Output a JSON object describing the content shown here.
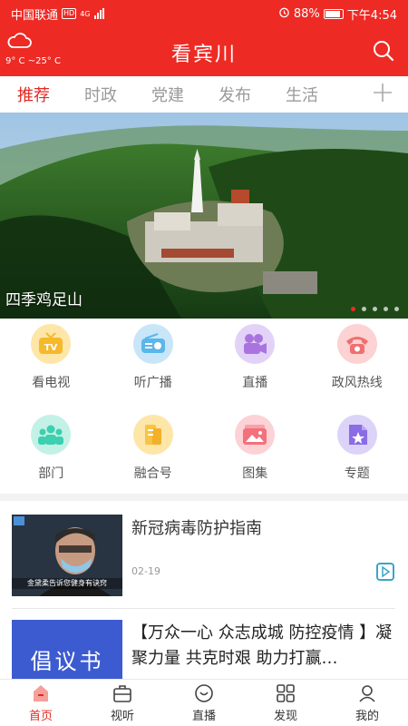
{
  "status": {
    "carrier": "中国联通",
    "network": "4G",
    "hd": "HD",
    "battery": "88%",
    "time": "下午4:54"
  },
  "header": {
    "title": "看宾川",
    "weather": {
      "temp": "9° C ~25° C"
    }
  },
  "tabs": [
    {
      "label": "推荐",
      "active": true
    },
    {
      "label": "时政"
    },
    {
      "label": "党建"
    },
    {
      "label": "发布"
    },
    {
      "label": "生活"
    }
  ],
  "banner": {
    "caption": "四季鸡足山",
    "dot_count": 5,
    "active_dot": 0
  },
  "shortcuts": [
    {
      "label": "看电视",
      "icon": "tv-icon",
      "color": "#f8c93e"
    },
    {
      "label": "听广播",
      "icon": "radio-icon",
      "color": "#5bb6ea"
    },
    {
      "label": "直播",
      "icon": "live-camera-icon",
      "color": "#a974e0"
    },
    {
      "label": "政风热线",
      "icon": "hotline-phone-icon",
      "color": "#f06f6f"
    },
    {
      "label": "部门",
      "icon": "department-icon",
      "color": "#3ccfb0"
    },
    {
      "label": "融合号",
      "icon": "media-account-icon",
      "color": "#f7c444"
    },
    {
      "label": "图集",
      "icon": "gallery-icon",
      "color": "#f4707a"
    },
    {
      "label": "专题",
      "icon": "topic-icon",
      "color": "#8a6ce6"
    }
  ],
  "news": [
    {
      "title": "新冠病毒防护指南",
      "date": "02-19",
      "thumb_caption": "金黛柔告诉您健身有诀窍"
    },
    {
      "title": "【万众一心 众志成城 防控疫情 】凝聚力量 共克时艰 助力打赢…",
      "thumb_text": "倡议书"
    }
  ],
  "bottom_nav": [
    {
      "label": "首页",
      "icon": "home-icon",
      "active": true
    },
    {
      "label": "视听",
      "icon": "briefcase-icon"
    },
    {
      "label": "直播",
      "icon": "live-icon"
    },
    {
      "label": "发现",
      "icon": "discover-grid-icon"
    },
    {
      "label": "我的",
      "icon": "profile-icon"
    }
  ],
  "colors": {
    "brand_red": "#ee2a24",
    "active_tab": "#e02a24"
  }
}
